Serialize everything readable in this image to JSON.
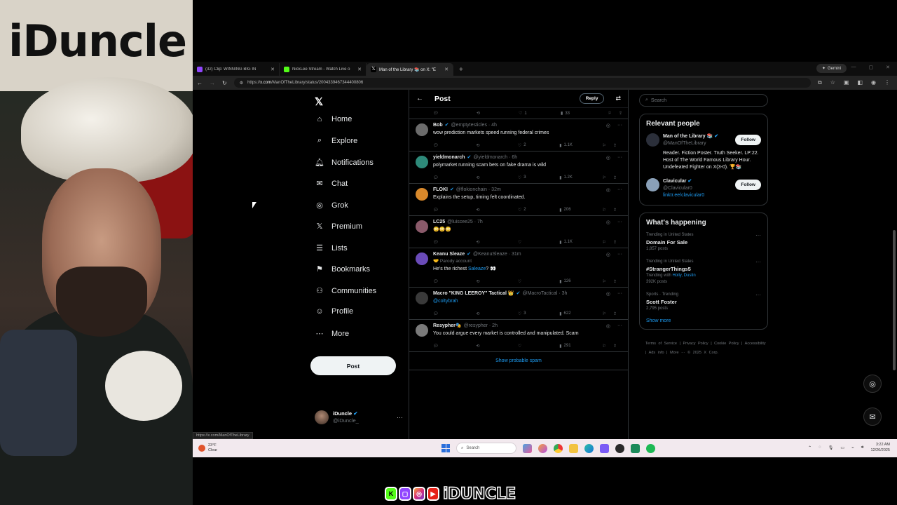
{
  "webcam": {
    "banner_text": "iDuncle"
  },
  "browser": {
    "tabs": [
      {
        "label": "(32) Clip: WINNING BIG IN",
        "color": "#9146ff",
        "active": false
      },
      {
        "label": "NickLee Stream - Watch Live o",
        "color": "#53fc18",
        "active": false
      },
      {
        "label": "Man of the Library 📚 on X: \"E",
        "color": "#000000",
        "active": true
      }
    ],
    "new_tab": "+",
    "gemini_label": "Gemini",
    "url_host": "x.com",
    "url_path": "/ManOfTheLibrary/status/2004339467344400806",
    "url_prefix": "https://",
    "status_url": "https://x.com/ManOfTheLibrary"
  },
  "x": {
    "nav": [
      {
        "label": "Home",
        "icon": "⌂",
        "name": "home"
      },
      {
        "label": "Explore",
        "icon": "⌕",
        "name": "explore"
      },
      {
        "label": "Notifications",
        "icon": "🔔︎",
        "name": "notifications"
      },
      {
        "label": "Chat",
        "icon": "✉",
        "name": "chat"
      },
      {
        "label": "Grok",
        "icon": "◎",
        "name": "grok"
      },
      {
        "label": "Premium",
        "icon": "𝕏",
        "name": "premium"
      },
      {
        "label": "Lists",
        "icon": "☰",
        "name": "lists"
      },
      {
        "label": "Bookmarks",
        "icon": "⚑",
        "name": "bookmarks"
      },
      {
        "label": "Communities",
        "icon": "⚇",
        "name": "communities"
      },
      {
        "label": "Profile",
        "icon": "☺",
        "name": "profile"
      },
      {
        "label": "More",
        "icon": "⋯",
        "name": "more"
      }
    ],
    "post_button": "Post",
    "account": {
      "name": "iDuncle",
      "handle": "@iDuncle_"
    },
    "header": {
      "title": "Post",
      "reply": "Reply"
    },
    "top_actions": {
      "likes": "1",
      "views": "33"
    },
    "replies": [
      {
        "name": "Bob",
        "handle": "@emptytesticles · 4h",
        "verified": true,
        "text": "wow prediction markets speed running federal crimes",
        "sub": "",
        "link": "",
        "retweets": "",
        "likes": "2",
        "views": "1.1K",
        "avatar": "#6b6b6b"
      },
      {
        "name": "yieldmonarch",
        "handle": "@yieldmonarch · 6h",
        "verified": true,
        "text": "polymarket running scam bets on fake drama is wild",
        "sub": "",
        "link": "",
        "retweets": "",
        "likes": "3",
        "views": "1.2K",
        "avatar": "#2e8a7a"
      },
      {
        "name": "FLOKI",
        "handle": "@flokionchain · 32m",
        "verified": true,
        "text": "Explains the setup, timing felt coordinated.",
        "sub": "",
        "link": "",
        "retweets": "",
        "likes": "2",
        "views": "206",
        "avatar": "#d9892b"
      },
      {
        "name": "LC25",
        "handle": "@luiscee25 · 7h",
        "verified": false,
        "text": "😳😳😳",
        "sub": "",
        "link": "",
        "retweets": "",
        "likes": "",
        "views": "1.1K",
        "avatar": "#8a5a6a"
      },
      {
        "name": "Keanu Sleaze",
        "handle": "@KeanuSleaze · 31m",
        "verified": true,
        "text": "He's the richest ",
        "sub": "🤝 Parody account",
        "link": "Saleaze",
        "text_after": "? 👀",
        "retweets": "",
        "likes": "",
        "views": "126",
        "avatar": "#6a4bb8"
      },
      {
        "name": "Macro \"KING LEEROY\" Tactical 👑",
        "handle": "@MacroTactical · 3h",
        "verified": true,
        "text": "",
        "sub": "",
        "link": "@coltybrah",
        "retweets": "",
        "likes": "3",
        "views": "622",
        "avatar": "#3a3a3a"
      },
      {
        "name": "Resypher🎭",
        "handle": "@resypher · 2h",
        "verified": false,
        "text": "You could argue every market is controlled and manipulated. Scam",
        "sub": "",
        "link": "",
        "retweets": "",
        "likes": "",
        "views": "291",
        "avatar": "#7a7a7a"
      }
    ],
    "show_spam": "Show probable spam",
    "search_placeholder": "Search",
    "relevant": {
      "title": "Relevant people",
      "people": [
        {
          "name": "Man of the Library 📚",
          "handle": "@ManOfTheLibrary",
          "bio": "Reader. Fiction Poster. Truth Seeker. LP:22. Host of The World Famous Library Hour. Undefeated Fighter on X(3-0). 🏆📚",
          "link": "",
          "follow": "Follow"
        },
        {
          "name": "Clavicular",
          "handle": "@Clavicular0",
          "bio": "",
          "link": "linktr.ee/clavicular0",
          "follow": "Follow"
        }
      ]
    },
    "happening": {
      "title": "What's happening",
      "trends": [
        {
          "context": "Trending in United States",
          "title": "Domain For Sale",
          "extra": "1,857 posts",
          "with": ""
        },
        {
          "context": "Trending in United States",
          "title": "#StrangerThings5",
          "extra": "392K posts",
          "with_prefix": "Trending with ",
          "with": "Holly, Dustin"
        },
        {
          "context": "Sports · Trending",
          "title": "Scott Foster",
          "extra": "2,795 posts",
          "with": ""
        }
      ],
      "show_more": "Show more"
    },
    "footer": "Terms of Service  |  Privacy Policy  |  Cookie Policy  |  Accessibility  |  Ads info  |  More ···  © 2025 X Corp."
  },
  "taskbar": {
    "weather_temp": "23°F",
    "weather_desc": "Clear",
    "search": "Search",
    "time": "3:22 AM",
    "date": "12/26/2025"
  },
  "social": {
    "name": "iDUNCLE"
  }
}
